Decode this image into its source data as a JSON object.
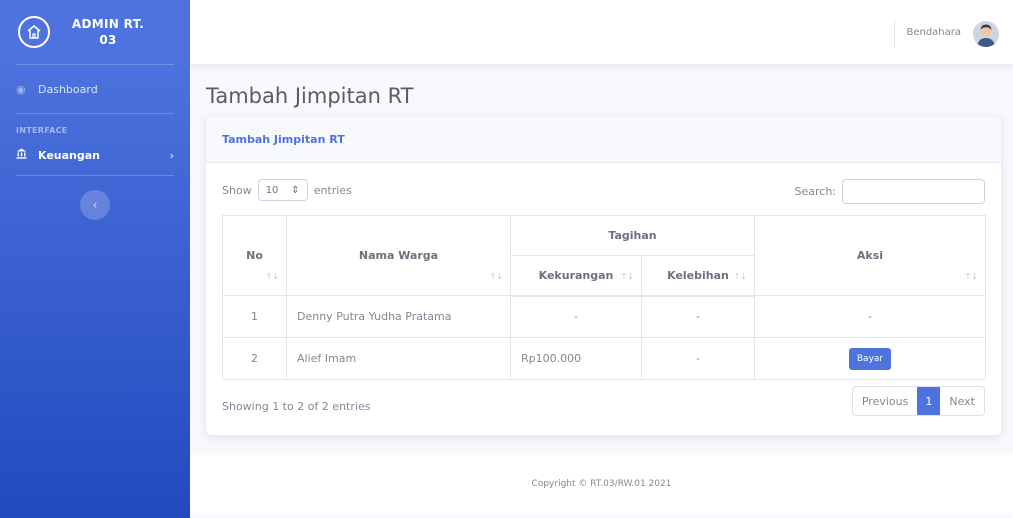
{
  "brand": {
    "title": "ADMIN RT. 03"
  },
  "sidebar": {
    "dashboard_label": "Dashboard",
    "heading": "INTERFACE",
    "keuangan_label": "Keuangan"
  },
  "topbar": {
    "user_name": "Bendahara"
  },
  "page": {
    "title": "Tambah Jimpitan RT"
  },
  "card": {
    "header": "Tambah Jimpitan RT",
    "show_label": "Show",
    "entries_value": "10",
    "entries_label": "entries",
    "search_label": "Search:",
    "search_value": ""
  },
  "table": {
    "group_header": "Tagihan",
    "columns": [
      "No",
      "Nama Warga",
      "Kekurangan",
      "Kelebihan",
      "Aksi"
    ],
    "rows": [
      {
        "no": "1",
        "nama": "Denny Putra Yudha Pratama",
        "kekurangan": "-",
        "kelebihan": "-",
        "aksi": "-"
      },
      {
        "no": "2",
        "nama": "Alief Imam",
        "kekurangan": "Rp100.000",
        "kelebihan": "-",
        "aksi": "Bayar"
      }
    ]
  },
  "pagination": {
    "info": "Showing 1 to 2 of 2 entries",
    "previous": "Previous",
    "current": "1",
    "next": "Next"
  },
  "footer": {
    "copyright": "Copyright © RT.03/RW.01 2021"
  },
  "colors": {
    "primary": "#4e73df",
    "sidebar_end": "#224abe"
  }
}
